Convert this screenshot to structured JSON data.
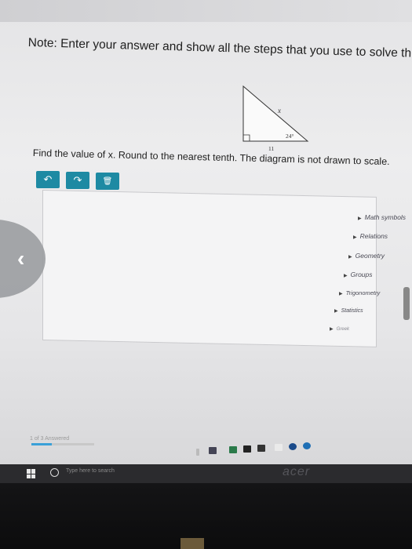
{
  "note": "Note: Enter your answer and show all the steps that you use to solve this problem in th",
  "diagram": {
    "side_hyp_label": "x",
    "angle_label": "24°",
    "base_label": "11"
  },
  "question": "Find the value of x. Round to the nearest tenth. The diagram is not drawn to scale.",
  "toolbar": {
    "undo_icon": "↶",
    "redo_icon": "↷",
    "delete_icon": "🗑"
  },
  "side_menu": [
    "Math symbols",
    "Relations",
    "Geometry",
    "Groups",
    "Trigonometry",
    "Statistics",
    "Greek"
  ],
  "progress": {
    "label": "1 of 3 Answered",
    "fraction": 0.33
  },
  "taskbar": {
    "search_placeholder": "Type here to search"
  },
  "brand": "acer",
  "colors": {
    "toolbar_button": "#1e8aa3",
    "progress_fill": "#3aa0d8"
  }
}
